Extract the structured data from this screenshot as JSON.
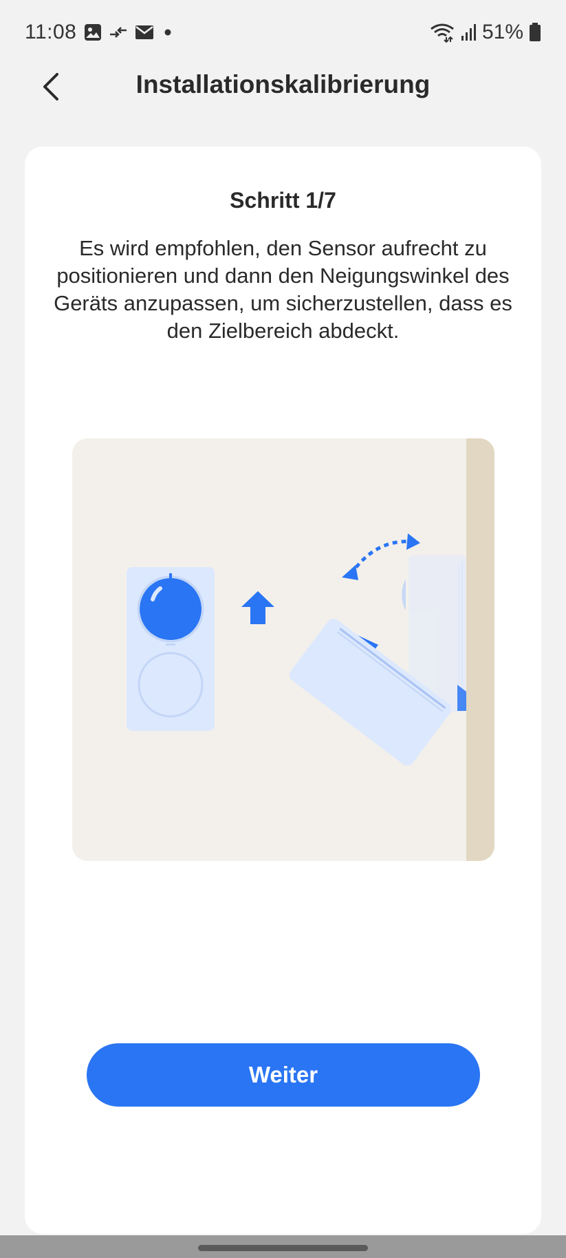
{
  "status_bar": {
    "time": "11:08",
    "battery": "51%",
    "icons_left": [
      "image-icon",
      "transfer-icon",
      "mail-icon",
      "dot-icon"
    ],
    "icons_right": [
      "wifi-icon",
      "signal-icon",
      "battery-icon"
    ]
  },
  "header": {
    "title": "Installationskalibrierung",
    "back_icon": "chevron-left-icon"
  },
  "content": {
    "step_label": "Schritt 1/7",
    "description": "Es wird empfohlen, den Sensor aufrecht zu positionieren und dann den Neigungswinkel des Geräts anzupassen, um sicherzustellen, dass es den Zielbereich abdeckt."
  },
  "actions": {
    "next_label": "Weiter"
  },
  "colors": {
    "accent": "#2a75f3",
    "light_accent": "#dce8fd",
    "illustration_bg": "#f3f0eb",
    "wall": "#e2d7c2"
  }
}
